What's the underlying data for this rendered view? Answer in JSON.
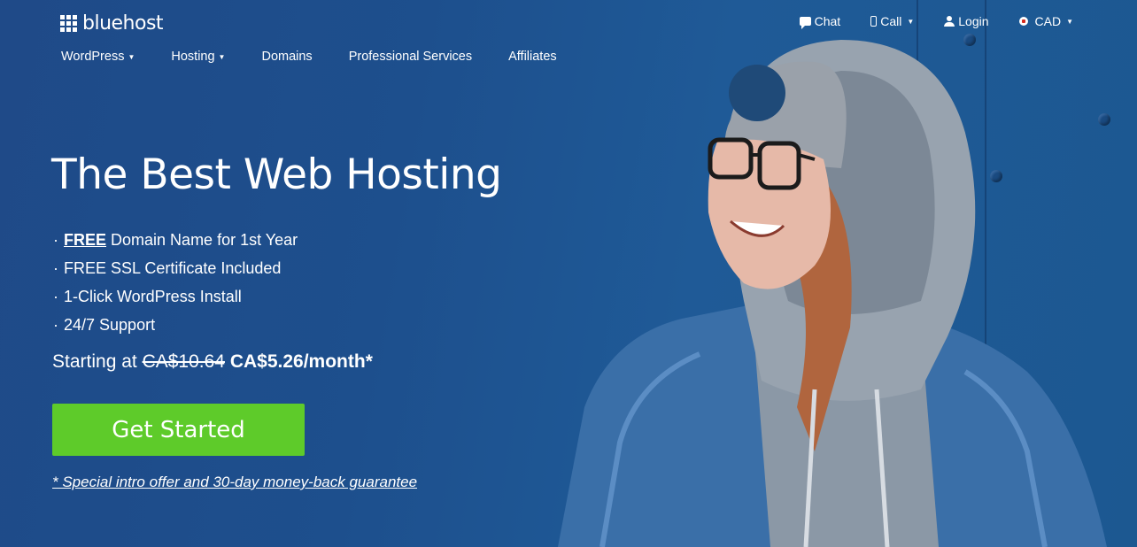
{
  "brand": {
    "name": "bluehost"
  },
  "utility_nav": {
    "chat": "Chat",
    "call": "Call",
    "login": "Login",
    "currency": "CAD"
  },
  "main_nav": {
    "items": [
      {
        "label": "WordPress",
        "has_dropdown": true
      },
      {
        "label": "Hosting",
        "has_dropdown": true
      },
      {
        "label": "Domains",
        "has_dropdown": false
      },
      {
        "label": "Professional Services",
        "has_dropdown": false
      },
      {
        "label": "Affiliates",
        "has_dropdown": false
      }
    ]
  },
  "hero": {
    "title": "The Best Web Hosting",
    "features": {
      "f1_bold": "FREE",
      "f1_rest": "Domain Name for 1st Year",
      "f2": "FREE SSL Certificate Included",
      "f3": "1-Click WordPress Install",
      "f4": "24/7 Support"
    },
    "bullet": "·",
    "price": {
      "prefix": "Starting at",
      "old": "CA$10.64",
      "new": "CA$5.26/month*"
    },
    "cta_label": "Get Started",
    "offer_note": "* Special intro offer and 30-day money-back guarantee"
  },
  "colors": {
    "background": "#1f4f8e",
    "cta": "#5ecb2a",
    "text": "#ffffff"
  },
  "icons": {
    "logo": "grid-logo-icon",
    "chat": "chat-bubble-icon",
    "call": "phone-icon",
    "login": "user-icon",
    "currency": "canada-flag-icon"
  }
}
